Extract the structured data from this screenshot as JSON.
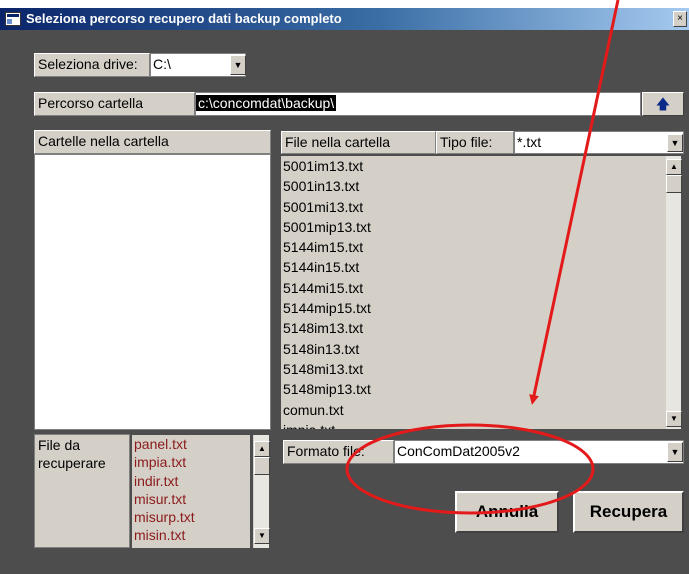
{
  "window": {
    "title": "Seleziona percorso recupero dati backup completo",
    "close_glyph": "×"
  },
  "drive": {
    "label": "Seleziona drive:",
    "value": "C:\\"
  },
  "path": {
    "label": "Percorso cartella",
    "value": "c:\\concomdat\\backup\\",
    "up_glyph": "🡅"
  },
  "folders": {
    "header": "Cartelle nella cartella",
    "items": []
  },
  "files": {
    "header": "File nella cartella",
    "type_label": "Tipo file:",
    "type_value": "*.txt",
    "items": [
      "5001im13.txt",
      "5001in13.txt",
      "5001mi13.txt",
      "5001mip13.txt",
      "5144im15.txt",
      "5144in15.txt",
      "5144mi15.txt",
      "5144mip15.txt",
      "5148im13.txt",
      "5148in13.txt",
      "5148mi13.txt",
      "5148mip13.txt",
      "comun.txt",
      "impia.txt"
    ]
  },
  "recover": {
    "label": "File da recuperare",
    "items": [
      "panel.txt",
      "impia.txt",
      "indir.txt",
      "misur.txt",
      "misurp.txt",
      "misin.txt"
    ]
  },
  "format": {
    "label": "Formato file:",
    "value": "ConComDat2005v2"
  },
  "buttons": {
    "cancel": "Annulla",
    "recover": "Recupera"
  },
  "colors": {
    "annotation": "#e41a1a",
    "list_text_recover": "#8b1a1a",
    "titlebar": "#0a246a"
  }
}
